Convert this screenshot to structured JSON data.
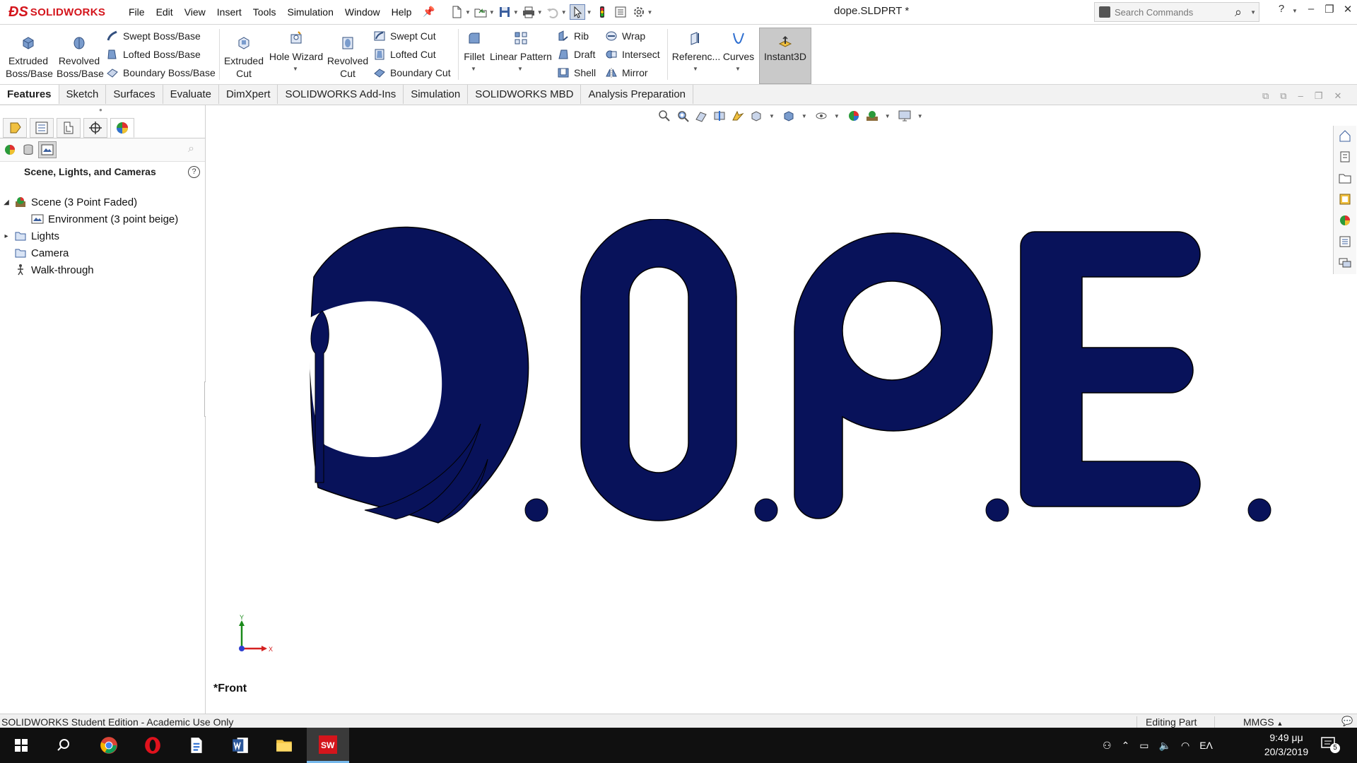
{
  "app": {
    "logo_text": "SOLIDWORKS",
    "document_title": "dope.SLDPRT *"
  },
  "menu": [
    "File",
    "Edit",
    "View",
    "Insert",
    "Tools",
    "Simulation",
    "Window",
    "Help"
  ],
  "search": {
    "placeholder": "Search Commands"
  },
  "ribbon": {
    "extruded_boss": "Extruded Boss/Base",
    "revolved_boss": "Revolved Boss/Base",
    "swept_boss": "Swept Boss/Base",
    "lofted_boss": "Lofted Boss/Base",
    "boundary_boss": "Boundary Boss/Base",
    "extruded_cut": "Extruded Cut",
    "hole_wizard": "Hole Wizard",
    "revolved_cut": "Revolved Cut",
    "swept_cut": "Swept Cut",
    "lofted_cut": "Lofted Cut",
    "boundary_cut": "Boundary Cut",
    "fillet": "Fillet",
    "linear_pattern": "Linear Pattern",
    "rib": "Rib",
    "draft": "Draft",
    "shell": "Shell",
    "wrap": "Wrap",
    "intersect": "Intersect",
    "mirror": "Mirror",
    "reference": "Referenc...",
    "curves": "Curves",
    "instant3d": "Instant3D"
  },
  "tabs": [
    "Features",
    "Sketch",
    "Surfaces",
    "Evaluate",
    "DimXpert",
    "SOLIDWORKS Add-Ins",
    "Simulation",
    "SOLIDWORKS MBD",
    "Analysis Preparation"
  ],
  "panel": {
    "title": "Scene, Lights, and Cameras",
    "tree": {
      "scene": "Scene (3 Point Faded)",
      "environment": "Environment (3 point beige)",
      "lights": "Lights",
      "camera": "Camera",
      "walkthrough": "Walk-through"
    }
  },
  "viewport": {
    "view_name": "*Front",
    "model_text": "D.O.P.E.",
    "model_color": "#08125a",
    "triad": {
      "x": "X",
      "y": "Y"
    }
  },
  "status": {
    "edition": "SOLIDWORKS Student Edition - Academic Use Only",
    "mode": "Editing Part",
    "units": "MMGS"
  },
  "taskbar": {
    "language": "ΕΛ",
    "time": "9:49 μμ",
    "date": "20/3/2019",
    "notifications": "5"
  }
}
